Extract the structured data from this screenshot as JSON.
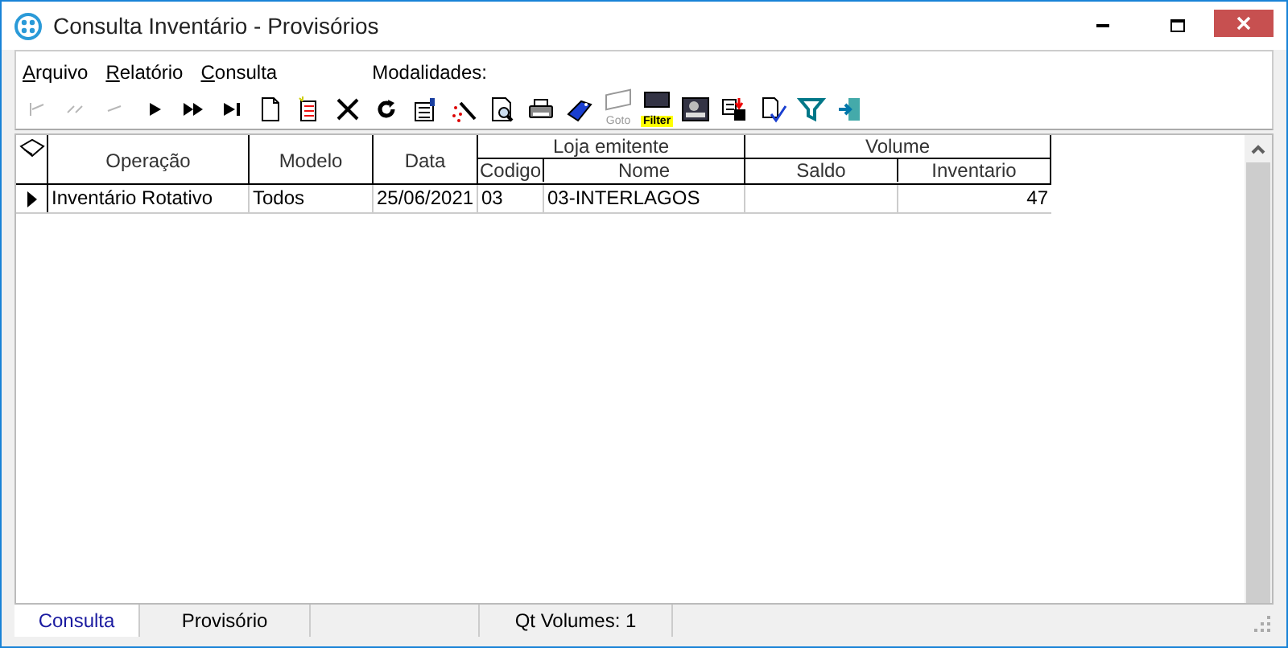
{
  "window": {
    "title": "Consulta Inventário - Provisórios"
  },
  "menu": [
    "Arquivo",
    "Relatório",
    "Consulta"
  ],
  "modalidades_label": "Modalidades:",
  "toolbar": [
    {
      "kind": "first",
      "disabled": true
    },
    {
      "kind": "prior",
      "disabled": true
    },
    {
      "kind": "prev",
      "disabled": true
    },
    {
      "kind": "next",
      "disabled": false
    },
    {
      "kind": "fastforward",
      "disabled": false
    },
    {
      "kind": "last",
      "disabled": false
    },
    {
      "kind": "new",
      "disabled": false
    },
    {
      "kind": "edit",
      "disabled": false
    },
    {
      "kind": "delete",
      "disabled": false
    },
    {
      "kind": "refresh",
      "disabled": false
    },
    {
      "kind": "form",
      "disabled": false
    },
    {
      "kind": "wand",
      "disabled": false
    },
    {
      "kind": "preview",
      "disabled": false
    },
    {
      "kind": "print",
      "disabled": false
    },
    {
      "kind": "tag",
      "disabled": false
    },
    {
      "kind": "goto",
      "disabled": true,
      "label": "Goto"
    },
    {
      "kind": "filter",
      "disabled": false,
      "label": "Filter"
    },
    {
      "kind": "monitor",
      "disabled": false
    },
    {
      "kind": "save",
      "disabled": false
    },
    {
      "kind": "check",
      "disabled": false
    },
    {
      "kind": "funnel",
      "disabled": false
    },
    {
      "kind": "exit",
      "disabled": false
    }
  ],
  "table": {
    "groups": [
      {
        "label": "Loja emitente"
      },
      {
        "label": "Volume"
      }
    ],
    "columns": [
      "Operação",
      "Modelo",
      "Data",
      "Codigo",
      "Nome",
      "Saldo",
      "Inventario"
    ],
    "rows": [
      {
        "selected": true,
        "cells": [
          "Inventário Rotativo",
          "Todos",
          "25/06/2021",
          "03",
          "03-INTERLAGOS",
          "",
          "47"
        ]
      }
    ]
  },
  "status_bar": {
    "tabs": [
      {
        "label": "Consulta",
        "selected": true
      },
      {
        "label": "Provisório",
        "selected": false
      }
    ],
    "volumes": "Qt Volumes: 1"
  }
}
